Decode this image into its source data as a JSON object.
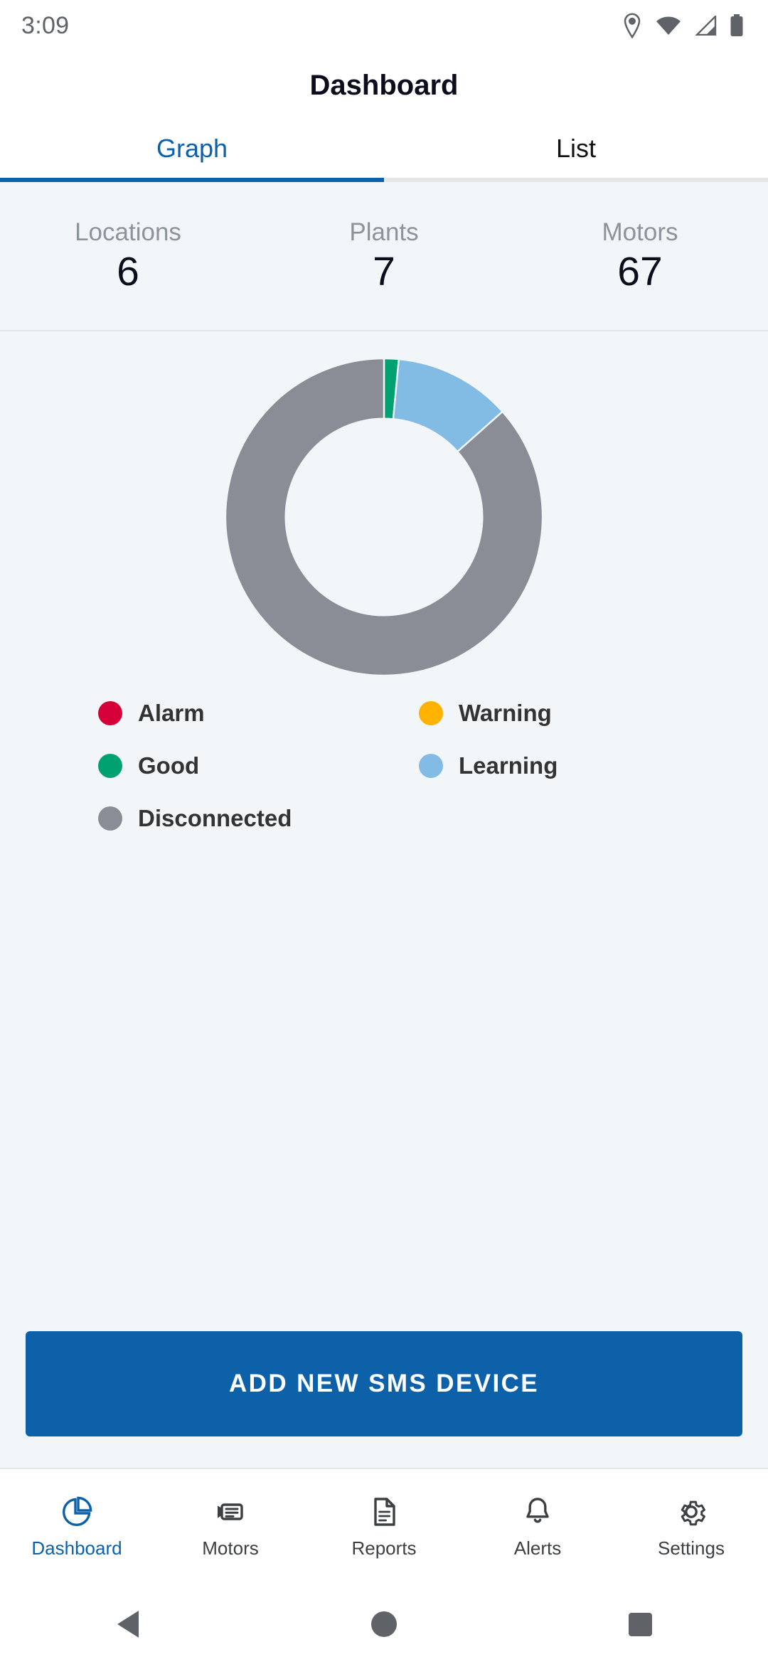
{
  "status_bar": {
    "time": "3:09",
    "icons": [
      "location-pin-icon",
      "wifi-icon",
      "cellular-signal-icon",
      "battery-icon"
    ]
  },
  "app_bar": {
    "title": "Dashboard"
  },
  "tabs": {
    "items": [
      {
        "label": "Graph",
        "active": true
      },
      {
        "label": "List",
        "active": false
      }
    ],
    "active_color": "#0d61a9"
  },
  "stats": [
    {
      "label": "Locations",
      "value": "6"
    },
    {
      "label": "Plants",
      "value": "7"
    },
    {
      "label": "Motors",
      "value": "67"
    }
  ],
  "chart_data": {
    "type": "pie",
    "variant": "donut",
    "title": "",
    "categories": [
      "Good",
      "Learning",
      "Disconnected",
      "Alarm",
      "Warning"
    ],
    "values": [
      1,
      8,
      58,
      0,
      0
    ],
    "unit": "motors",
    "total": 67,
    "percentages": [
      1.5,
      11.9,
      86.6,
      0,
      0
    ],
    "colors": [
      "#00a170",
      "#82bce5",
      "#8b8d96",
      "#d50038",
      "#ffb300"
    ],
    "start_angle_deg": 0,
    "direction": "clockwise",
    "inner_radius_ratio": 0.62,
    "legend_position": "below"
  },
  "legend": {
    "items": [
      {
        "label": "Alarm",
        "color": "#d50038"
      },
      {
        "label": "Warning",
        "color": "#ffb300"
      },
      {
        "label": "Good",
        "color": "#00a170"
      },
      {
        "label": "Learning",
        "color": "#82bce5"
      },
      {
        "label": "Disconnected",
        "color": "#8b8d96"
      }
    ]
  },
  "cta": {
    "label": "ADD NEW SMS DEVICE",
    "color": "#0d61a9"
  },
  "bottom_nav": {
    "items": [
      {
        "label": "Dashboard",
        "icon": "pie-chart-icon",
        "active": true
      },
      {
        "label": "Motors",
        "icon": "motor-icon",
        "active": false
      },
      {
        "label": "Reports",
        "icon": "document-icon",
        "active": false
      },
      {
        "label": "Alerts",
        "icon": "bell-icon",
        "active": false
      },
      {
        "label": "Settings",
        "icon": "gear-icon",
        "active": false
      }
    ]
  },
  "system_nav": {
    "back": "back-triangle-icon",
    "home": "home-circle-icon",
    "recents": "recents-square-icon"
  }
}
